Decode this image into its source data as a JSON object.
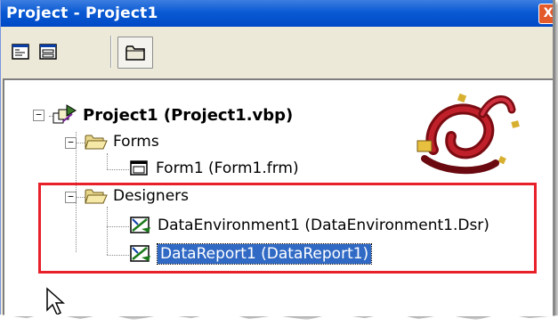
{
  "window": {
    "title": "Project - Project1",
    "close_glyph": "X"
  },
  "toolbar": {
    "buttons": [
      {
        "name": "view-code",
        "icon": "view-code-icon"
      },
      {
        "name": "view-object",
        "icon": "view-object-icon"
      },
      {
        "name": "toggle-folders",
        "icon": "folder-icon"
      }
    ]
  },
  "tree": {
    "root": {
      "label": "Project1 (Project1.vbp)",
      "expander": "−"
    },
    "forms": {
      "label": "Forms",
      "expander": "−",
      "items": [
        {
          "label": "Form1 (Form1.frm)"
        }
      ]
    },
    "designers": {
      "label": "Designers",
      "expander": "−",
      "items": [
        {
          "label": "DataEnvironment1 (DataEnvironment1.Dsr)"
        },
        {
          "label": "DataReport1 (DataReport1)",
          "selected": true
        }
      ]
    }
  },
  "colors": {
    "titlebar": "#0a5ad4",
    "selection": "#316ac5",
    "highlight_box": "#e8202a"
  }
}
